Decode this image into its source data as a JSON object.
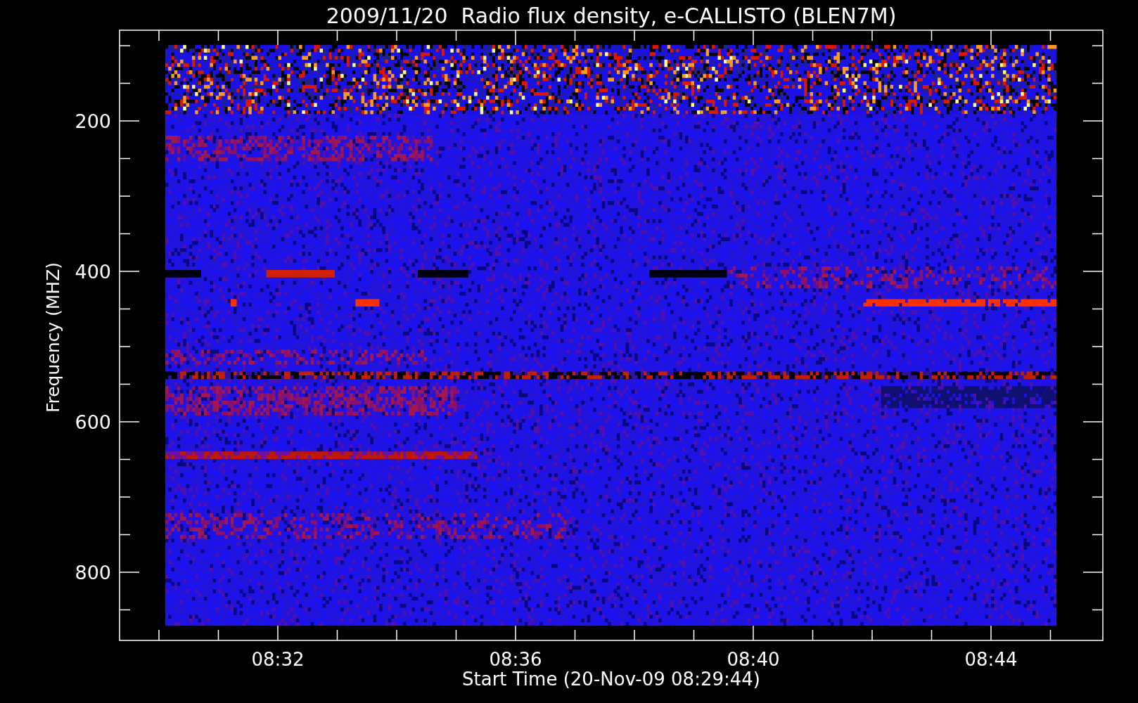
{
  "title": "2009/11/20  Radio flux density, e-CALLISTO (BLEN7M)",
  "y_axis": {
    "label": "Frequency (MHZ)",
    "ticks": [
      "200",
      "400",
      "600",
      "800"
    ]
  },
  "x_axis": {
    "label": "Start Time (20-Nov-09 08:29:44)",
    "ticks": [
      "08:32",
      "08:36",
      "08:40",
      "08:44"
    ]
  }
}
